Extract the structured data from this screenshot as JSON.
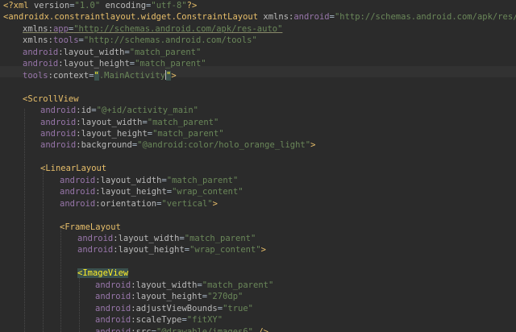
{
  "lines": [
    {
      "segments": [
        {
          "cls": "pi",
          "text": "<?xml "
        },
        {
          "cls": "pi-attr",
          "text": "version"
        },
        {
          "cls": "plain",
          "text": "="
        },
        {
          "cls": "val",
          "text": "\"1.0\""
        },
        {
          "cls": "pi-attr",
          "text": " encoding"
        },
        {
          "cls": "plain",
          "text": "="
        },
        {
          "cls": "val",
          "text": "\"utf-8\""
        },
        {
          "cls": "pi",
          "text": "?>"
        }
      ]
    },
    {
      "segments": [
        {
          "cls": "tag",
          "text": "<androidx.constraintlayout.widget.ConstraintLayout "
        },
        {
          "cls": "attr",
          "text": "xmlns:"
        },
        {
          "cls": "ns",
          "text": "android"
        },
        {
          "cls": "plain",
          "text": "="
        },
        {
          "cls": "val",
          "text": "\"http://schemas.android.com/apk/res/android\""
        }
      ]
    },
    {
      "segments": [
        {
          "cls": "attr warn",
          "text": "xmlns:"
        },
        {
          "cls": "ns warn",
          "text": "app"
        },
        {
          "cls": "plain warn",
          "text": "="
        },
        {
          "cls": "val warn",
          "text": "\"http://schemas.android.com/apk/res-auto\""
        }
      ]
    },
    {
      "segments": [
        {
          "cls": "attr",
          "text": "xmlns:"
        },
        {
          "cls": "ns",
          "text": "tools"
        },
        {
          "cls": "plain",
          "text": "="
        },
        {
          "cls": "val",
          "text": "\"http://schemas.android.com/tools\""
        }
      ]
    },
    {
      "segments": [
        {
          "cls": "ns",
          "text": "android"
        },
        {
          "cls": "attr",
          "text": ":layout_width"
        },
        {
          "cls": "plain",
          "text": "="
        },
        {
          "cls": "val",
          "text": "\"match_parent\""
        }
      ]
    },
    {
      "segments": [
        {
          "cls": "ns",
          "text": "android"
        },
        {
          "cls": "attr",
          "text": ":layout_height"
        },
        {
          "cls": "plain",
          "text": "="
        },
        {
          "cls": "val",
          "text": "\"match_parent\""
        }
      ]
    },
    {
      "segments": [
        {
          "cls": "ns",
          "text": "tools"
        },
        {
          "cls": "attr",
          "text": ":context"
        },
        {
          "cls": "plain",
          "text": "="
        },
        {
          "cls": "val match",
          "text": "\""
        },
        {
          "cls": "val",
          "text": ".MainActivity"
        },
        {
          "cls": "caret",
          "text": ""
        },
        {
          "cls": "val match",
          "text": "\""
        },
        {
          "cls": "tag",
          "text": ">"
        }
      ]
    },
    {
      "segments": []
    },
    {
      "segments": [
        {
          "cls": "tag",
          "text": "<ScrollView"
        }
      ]
    },
    {
      "segments": [
        {
          "cls": "ns",
          "text": "android"
        },
        {
          "cls": "attr",
          "text": ":id"
        },
        {
          "cls": "plain",
          "text": "="
        },
        {
          "cls": "val",
          "text": "\"@+id/activity_main\""
        }
      ]
    },
    {
      "segments": [
        {
          "cls": "ns",
          "text": "android"
        },
        {
          "cls": "attr",
          "text": ":layout_width"
        },
        {
          "cls": "plain",
          "text": "="
        },
        {
          "cls": "val",
          "text": "\"match_parent\""
        }
      ]
    },
    {
      "segments": [
        {
          "cls": "ns",
          "text": "android"
        },
        {
          "cls": "attr",
          "text": ":layout_height"
        },
        {
          "cls": "plain",
          "text": "="
        },
        {
          "cls": "val",
          "text": "\"match_parent\""
        }
      ]
    },
    {
      "segments": [
        {
          "cls": "ns",
          "text": "android"
        },
        {
          "cls": "attr",
          "text": ":background"
        },
        {
          "cls": "plain",
          "text": "="
        },
        {
          "cls": "val",
          "text": "\"@android:color/holo_orange_light\""
        },
        {
          "cls": "tag",
          "text": ">"
        }
      ]
    },
    {
      "segments": []
    },
    {
      "segments": [
        {
          "cls": "tag",
          "text": "<LinearLayout"
        }
      ]
    },
    {
      "segments": [
        {
          "cls": "ns",
          "text": "android"
        },
        {
          "cls": "attr",
          "text": ":layout_width"
        },
        {
          "cls": "plain",
          "text": "="
        },
        {
          "cls": "val",
          "text": "\"match_parent\""
        }
      ]
    },
    {
      "segments": [
        {
          "cls": "ns",
          "text": "android"
        },
        {
          "cls": "attr",
          "text": ":layout_height"
        },
        {
          "cls": "plain",
          "text": "="
        },
        {
          "cls": "val",
          "text": "\"wrap_content\""
        }
      ]
    },
    {
      "segments": [
        {
          "cls": "ns",
          "text": "android"
        },
        {
          "cls": "attr",
          "text": ":orientation"
        },
        {
          "cls": "plain",
          "text": "="
        },
        {
          "cls": "val",
          "text": "\"vertical\""
        },
        {
          "cls": "tag",
          "text": ">"
        }
      ]
    },
    {
      "segments": []
    },
    {
      "segments": [
        {
          "cls": "tag",
          "text": "<FrameLayout"
        }
      ]
    },
    {
      "segments": [
        {
          "cls": "ns",
          "text": "android"
        },
        {
          "cls": "attr",
          "text": ":layout_width"
        },
        {
          "cls": "plain",
          "text": "="
        },
        {
          "cls": "val",
          "text": "\"match_parent\""
        }
      ]
    },
    {
      "segments": [
        {
          "cls": "ns",
          "text": "android"
        },
        {
          "cls": "attr",
          "text": ":layout_height"
        },
        {
          "cls": "plain",
          "text": "="
        },
        {
          "cls": "val",
          "text": "\"wrap_content\""
        },
        {
          "cls": "tag",
          "text": ">"
        }
      ]
    },
    {
      "segments": []
    },
    {
      "segments": [
        {
          "cls": "tag match",
          "text": "<ImageView"
        }
      ]
    },
    {
      "segments": [
        {
          "cls": "ns",
          "text": "android"
        },
        {
          "cls": "attr",
          "text": ":layout_width"
        },
        {
          "cls": "plain",
          "text": "="
        },
        {
          "cls": "val",
          "text": "\"match_parent\""
        }
      ]
    },
    {
      "segments": [
        {
          "cls": "ns",
          "text": "android"
        },
        {
          "cls": "attr",
          "text": ":layout_height"
        },
        {
          "cls": "plain",
          "text": "="
        },
        {
          "cls": "val",
          "text": "\"270dp\""
        }
      ]
    },
    {
      "segments": [
        {
          "cls": "ns",
          "text": "android"
        },
        {
          "cls": "attr",
          "text": ":adjustViewBounds"
        },
        {
          "cls": "plain",
          "text": "="
        },
        {
          "cls": "val",
          "text": "\"true\""
        }
      ]
    },
    {
      "segments": [
        {
          "cls": "ns",
          "text": "android"
        },
        {
          "cls": "attr",
          "text": ":scaleType"
        },
        {
          "cls": "plain",
          "text": "="
        },
        {
          "cls": "val",
          "text": "\"fitXY\""
        }
      ]
    },
    {
      "segments": [
        {
          "cls": "ns",
          "text": "android"
        },
        {
          "cls": "attr",
          "text": ":src"
        },
        {
          "cls": "plain",
          "text": "="
        },
        {
          "cls": "val",
          "text": "\"@drawable/images6\""
        },
        {
          "cls": "tag",
          "text": " />"
        }
      ]
    }
  ]
}
